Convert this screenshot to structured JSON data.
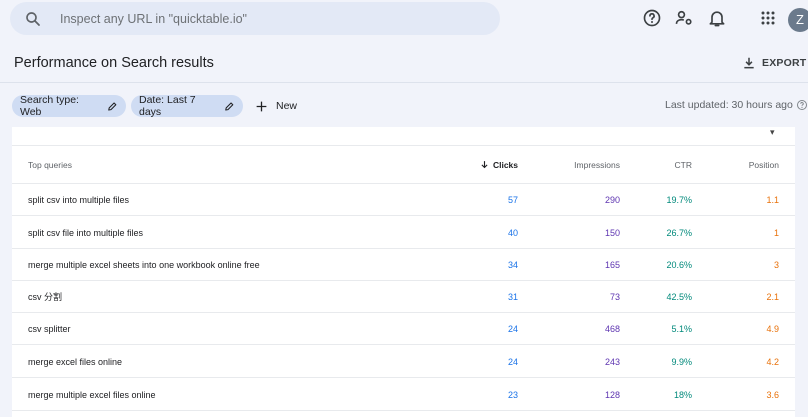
{
  "search": {
    "placeholder": "Inspect any URL in \"quicktable.io\""
  },
  "header": {
    "help_icon": "help-circle-icon",
    "account_icon": "manage-accounts-icon",
    "bell_icon": "bell-icon",
    "apps_icon": "apps-grid-icon",
    "avatar_letter": "Z"
  },
  "page": {
    "title": "Performance on Search results",
    "export_label": "EXPORT"
  },
  "filters": {
    "search_type": "Search type: Web",
    "date": "Date: Last 7 days",
    "new_label": "New",
    "last_updated": "Last updated: 30 hours ago"
  },
  "table": {
    "columns": {
      "query": "Top queries",
      "clicks": "Clicks",
      "impressions": "Impressions",
      "ctr": "CTR",
      "position": "Position"
    },
    "rows": [
      {
        "query": "split csv into multiple files",
        "clicks": "57",
        "impressions": "290",
        "ctr": "19.7%",
        "position": "1.1"
      },
      {
        "query": "split csv file into multiple files",
        "clicks": "40",
        "impressions": "150",
        "ctr": "26.7%",
        "position": "1"
      },
      {
        "query": "merge multiple excel sheets into one workbook online free",
        "clicks": "34",
        "impressions": "165",
        "ctr": "20.6%",
        "position": "3"
      },
      {
        "query": "csv 分割",
        "clicks": "31",
        "impressions": "73",
        "ctr": "42.5%",
        "position": "2.1"
      },
      {
        "query": "csv splitter",
        "clicks": "24",
        "impressions": "468",
        "ctr": "5.1%",
        "position": "4.9"
      },
      {
        "query": "merge excel files online",
        "clicks": "24",
        "impressions": "243",
        "ctr": "9.9%",
        "position": "4.2"
      },
      {
        "query": "merge multiple excel files online",
        "clicks": "23",
        "impressions": "128",
        "ctr": "18%",
        "position": "3.6"
      }
    ]
  },
  "colors": {
    "clicks": "#1a73e8",
    "impressions": "#5e35b1",
    "ctr": "#00897b",
    "position": "#e8710a",
    "chip_bg": "#cfdcf3"
  }
}
